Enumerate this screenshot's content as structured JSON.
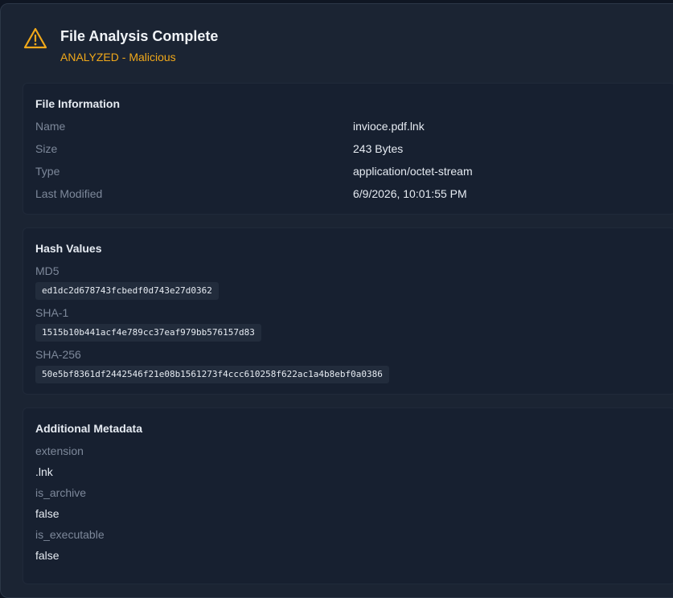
{
  "header": {
    "icon": "warning-triangle-icon",
    "title": "File Analysis Complete",
    "status": "ANALYZED - Malicious",
    "status_color": "#f0a81a"
  },
  "file_information": {
    "title": "File Information",
    "rows": [
      {
        "label": "Name",
        "value": "invioce.pdf.lnk"
      },
      {
        "label": "Size",
        "value": "243 Bytes"
      },
      {
        "label": "Type",
        "value": "application/octet-stream"
      },
      {
        "label": "Last Modified",
        "value": "6/9/2026, 10:01:55 PM"
      }
    ]
  },
  "hash_values": {
    "title": "Hash Values",
    "items": [
      {
        "label": "MD5",
        "value": "ed1dc2d678743fcbedf0d743e27d0362"
      },
      {
        "label": "SHA-1",
        "value": "1515b10b441acf4e789cc37eaf979bb576157d83"
      },
      {
        "label": "SHA-256",
        "value": "50e5bf8361df2442546f21e08b1561273f4ccc610258f622ac1a4b8ebf0a0386"
      }
    ]
  },
  "additional_metadata": {
    "title": "Additional Metadata",
    "items": [
      {
        "label": "extension",
        "value": ".lnk"
      },
      {
        "label": "is_archive",
        "value": "false"
      },
      {
        "label": "is_executable",
        "value": "false"
      }
    ]
  }
}
